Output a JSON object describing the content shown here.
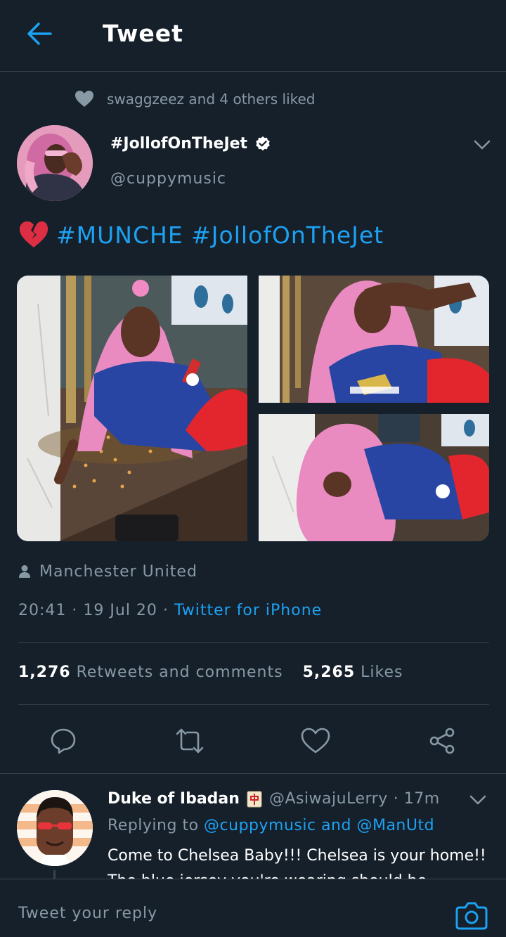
{
  "header": {
    "title": "Tweet"
  },
  "social_context": {
    "text": "swaggzeez and 4 others liked"
  },
  "tweet": {
    "display_name": "#JollofOnTheJet",
    "handle": "@cuppymusic",
    "text": "#MUNCHE #JollofOnTheJet",
    "location": "Manchester United",
    "time": "20:41",
    "date": "19 Jul 20",
    "separator": "·",
    "source": "Twitter for iPhone",
    "retweets_count": "1,276",
    "retweets_label": "Retweets and comments",
    "likes_count": "5,265",
    "likes_label": "Likes"
  },
  "actions": [
    "reply-icon",
    "retweet-icon",
    "like-icon",
    "share-icon"
  ],
  "reply": {
    "name": "Duke of Ibadan",
    "handle": "@AsiwajuLerry",
    "time": "· 17m",
    "replying_prefix": "Replying to",
    "mention_1": "@cuppymusic",
    "and": "and",
    "mention_2": "@ManUtd",
    "text": "Come to Chelsea Baby!!! Chelsea is your home!! The blue jersey you're wearing should be"
  },
  "composer": {
    "placeholder": "Tweet your reply"
  },
  "colors": {
    "background": "#15202b",
    "accent": "#1da1f2",
    "muted": "#8899a6",
    "divider": "#38444d"
  }
}
